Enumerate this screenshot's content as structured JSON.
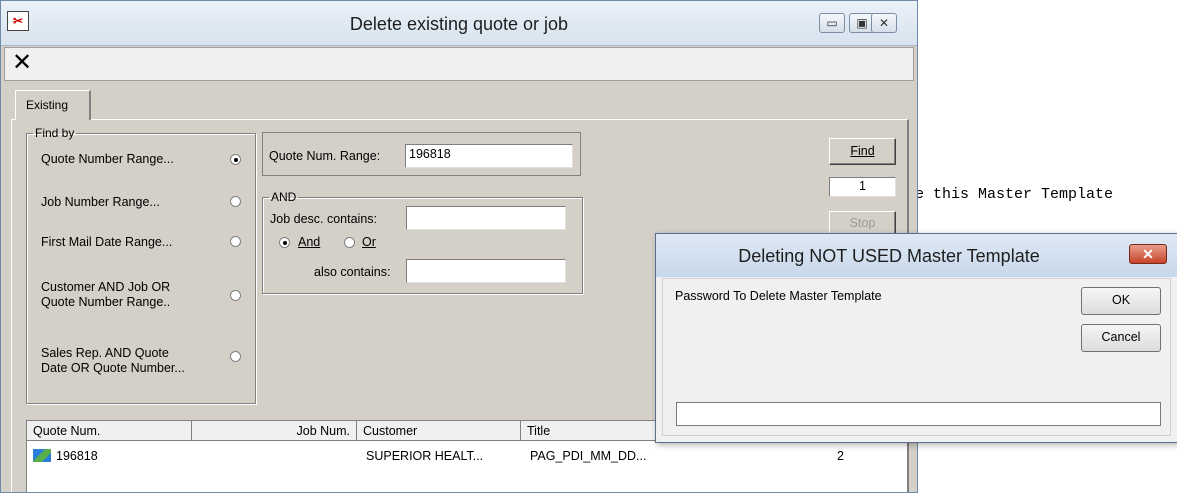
{
  "background": {
    "text": "e this Master Template"
  },
  "main_window": {
    "title": "Delete existing quote or job",
    "app_icon": "scissors-icon",
    "minimize_glyph": "▭",
    "maximize_glyph": "▣",
    "close_glyph": "✕",
    "toolbar": {
      "close_glyph": "✕"
    },
    "tab_label": "Existing",
    "find_by": {
      "legend": "Find by",
      "options": [
        {
          "line1": "Quote Number Range...",
          "line2": "",
          "selected": true
        },
        {
          "line1": "Job Number Range...",
          "line2": "",
          "selected": false
        },
        {
          "line1": "First Mail Date Range...",
          "line2": "",
          "selected": false
        },
        {
          "line1": "Customer AND Job OR",
          "line2": "Quote Number Range..",
          "selected": false
        },
        {
          "line1": "Sales Rep. AND Quote",
          "line2": "Date OR Quote Number...",
          "selected": false
        }
      ]
    },
    "quote_range": {
      "label": "Quote Num. Range:",
      "value": "196818"
    },
    "and_group": {
      "legend": "AND",
      "job_desc_label": "Job desc. contains:",
      "job_desc_value": "",
      "and_label": "And",
      "or_label": "Or",
      "also_label": "also contains:",
      "also_value": ""
    },
    "buttons": {
      "find": "Find",
      "count": "1",
      "stop": "Stop"
    },
    "list": {
      "headers": [
        "Quote Num.",
        "Job Num.",
        "Customer",
        "Title"
      ],
      "rows": [
        {
          "quote": "196818",
          "job": "",
          "customer": "SUPERIOR HEALT...",
          "title": "PAG_PDI_MM_DD...",
          "extra": "2"
        }
      ]
    }
  },
  "dialog": {
    "title": "Deleting NOT USED Master Template",
    "close_glyph": "✕",
    "prompt": "Password To Delete Master Template",
    "ok": "OK",
    "cancel": "Cancel",
    "password_value": ""
  }
}
